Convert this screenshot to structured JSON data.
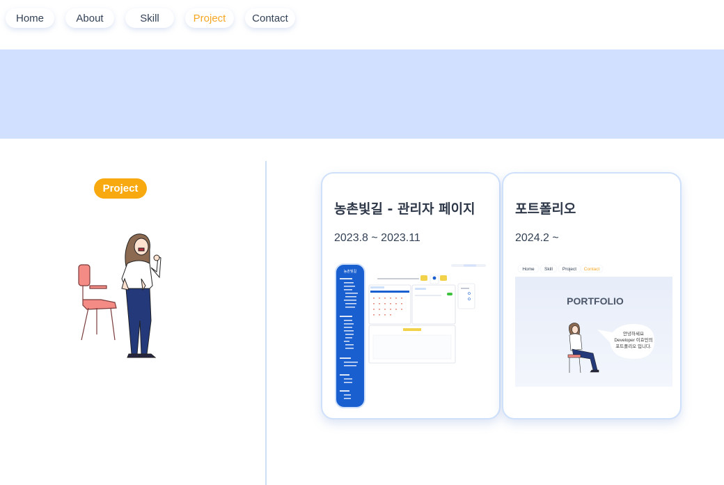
{
  "nav": {
    "items": [
      {
        "label": "Home",
        "active": false
      },
      {
        "label": "About",
        "active": false
      },
      {
        "label": "Skill",
        "active": false
      },
      {
        "label": "Project",
        "active": true
      },
      {
        "label": "Contact",
        "active": false
      }
    ]
  },
  "section": {
    "badge": "Project"
  },
  "projects": [
    {
      "title": "농촌빛길 - 관리자 페이지",
      "date": "2023.8 ~ 2023.11"
    },
    {
      "title": "포트폴리오",
      "date": "2024.2 ~"
    }
  ],
  "portfolio_thumb": {
    "nav": [
      "Home",
      "Skill",
      "Project",
      "Contact"
    ],
    "heading": "PORTFOLIO",
    "bubble_lines": [
      "안녕하세요",
      "Developer 이효민의",
      "포트폴리오 입니다."
    ]
  },
  "admin_thumb": {
    "sidebar_title": "농촌빛길"
  },
  "colors": {
    "accent": "#f8a90f",
    "banner": "#d2e0ff",
    "card_border": "#cfe0fb",
    "sidebar_blue": "#1a5fd0"
  }
}
